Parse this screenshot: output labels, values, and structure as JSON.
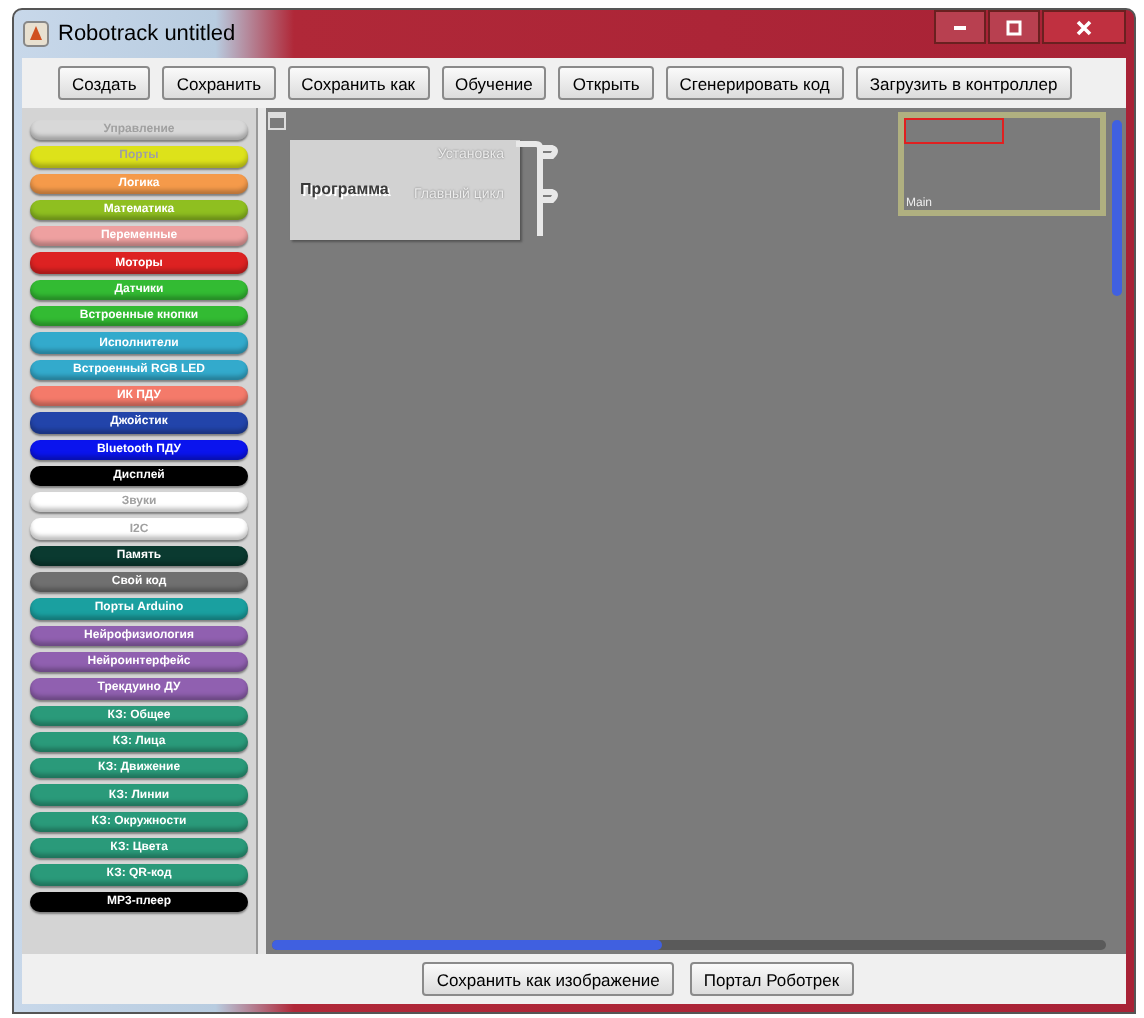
{
  "window": {
    "title": "Robotrack untitled"
  },
  "toolbar": [
    "Создать",
    "Сохранить",
    "Сохранить как",
    "Обучение",
    "Открыть",
    "Сгенерировать код",
    "Загрузить в контроллер"
  ],
  "palette": [
    {
      "label": "Управление",
      "color": "#d8d8d8"
    },
    {
      "label": "Порты",
      "color": "#dde21a"
    },
    {
      "label": "Логика",
      "color": "#f59a4a"
    },
    {
      "label": "Математика",
      "color": "#8fbf20"
    },
    {
      "label": "Переменные",
      "color": "#eea0a0"
    },
    {
      "label": "Моторы",
      "color": "#dd2222"
    },
    {
      "label": "Датчики",
      "color": "#33bb33"
    },
    {
      "label": "Встроенные кнопки",
      "color": "#33bb33"
    },
    {
      "label": "Исполнители",
      "color": "#33aacc"
    },
    {
      "label": "Встроенный RGB LED",
      "color": "#33aacc"
    },
    {
      "label": "ИК ПДУ",
      "color": "#f47a6a"
    },
    {
      "label": "Джойстик",
      "color": "#2244aa"
    },
    {
      "label": "Bluetooth ПДУ",
      "color": "#0a14ee"
    },
    {
      "label": "Дисплей",
      "color": "#000000"
    },
    {
      "label": "Звуки",
      "color": "#ffffff"
    },
    {
      "label": "I2C",
      "color": "#ffffff"
    },
    {
      "label": "Память",
      "color": "#0a3a30"
    },
    {
      "label": "Свой код",
      "color": "#707070"
    },
    {
      "label": "Порты Arduino",
      "color": "#1aa0a0"
    },
    {
      "label": "Нейрофизиология",
      "color": "#9060b0"
    },
    {
      "label": "Нейроинтерфейс",
      "color": "#9060b0"
    },
    {
      "label": "Трекдуино ДУ",
      "color": "#9060b0"
    },
    {
      "label": "КЗ: Общее",
      "color": "#2a9a7a"
    },
    {
      "label": "КЗ: Лица",
      "color": "#2a9a7a"
    },
    {
      "label": "КЗ: Движение",
      "color": "#2a9a7a"
    },
    {
      "label": "КЗ: Линии",
      "color": "#2a9a7a"
    },
    {
      "label": "КЗ: Окружности",
      "color": "#2a9a7a"
    },
    {
      "label": "КЗ: Цвета",
      "color": "#2a9a7a"
    },
    {
      "label": "КЗ: QR-код",
      "color": "#2a9a7a"
    },
    {
      "label": "MP3-плеер",
      "color": "#000000"
    }
  ],
  "canvas": {
    "block": {
      "title": "Программа",
      "slots": [
        "Установка",
        "Главный цикл"
      ]
    },
    "minimap": {
      "label": "Main"
    }
  },
  "bottom_buttons": [
    "Сохранить как изображение",
    "Портал Роботрек"
  ]
}
